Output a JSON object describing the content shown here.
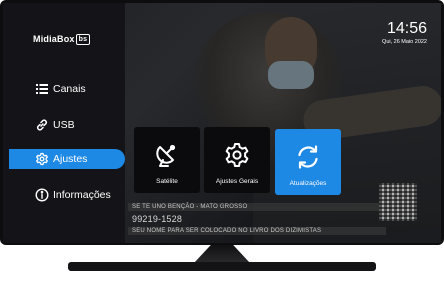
{
  "logo": {
    "text": "MidiaBox",
    "badge": "bs"
  },
  "clock": {
    "time": "14:56",
    "date": "Qui, 26 Maio 2022"
  },
  "sidebar": {
    "items": [
      {
        "label": "Canais",
        "icon": "list-icon",
        "active": false
      },
      {
        "label": "USB",
        "icon": "link-icon",
        "active": false
      },
      {
        "label": "Ajustes",
        "icon": "gear-icon",
        "active": true
      },
      {
        "label": "Informações",
        "icon": "info-icon",
        "active": false
      }
    ]
  },
  "tiles": [
    {
      "label": "Satélite",
      "icon": "satellite-dish-icon",
      "active": false
    },
    {
      "label": "Ajustes Gerais",
      "icon": "gear-icon",
      "active": false
    },
    {
      "label": "Atualizações",
      "icon": "refresh-icon",
      "active": true
    }
  ],
  "background": {
    "news_line_1": "SE TE UNO BENÇÃO - MATO GROSSO",
    "news_line_2": "99219-1528",
    "news_line_3": "SEU NOME PARA SER COLOCADO NO LIVRO DOS DIZIMISTAS"
  },
  "colors": {
    "accent": "#1e88e5",
    "sidebar_bg": "#141418",
    "tile_bg": "#0b0b0d"
  }
}
